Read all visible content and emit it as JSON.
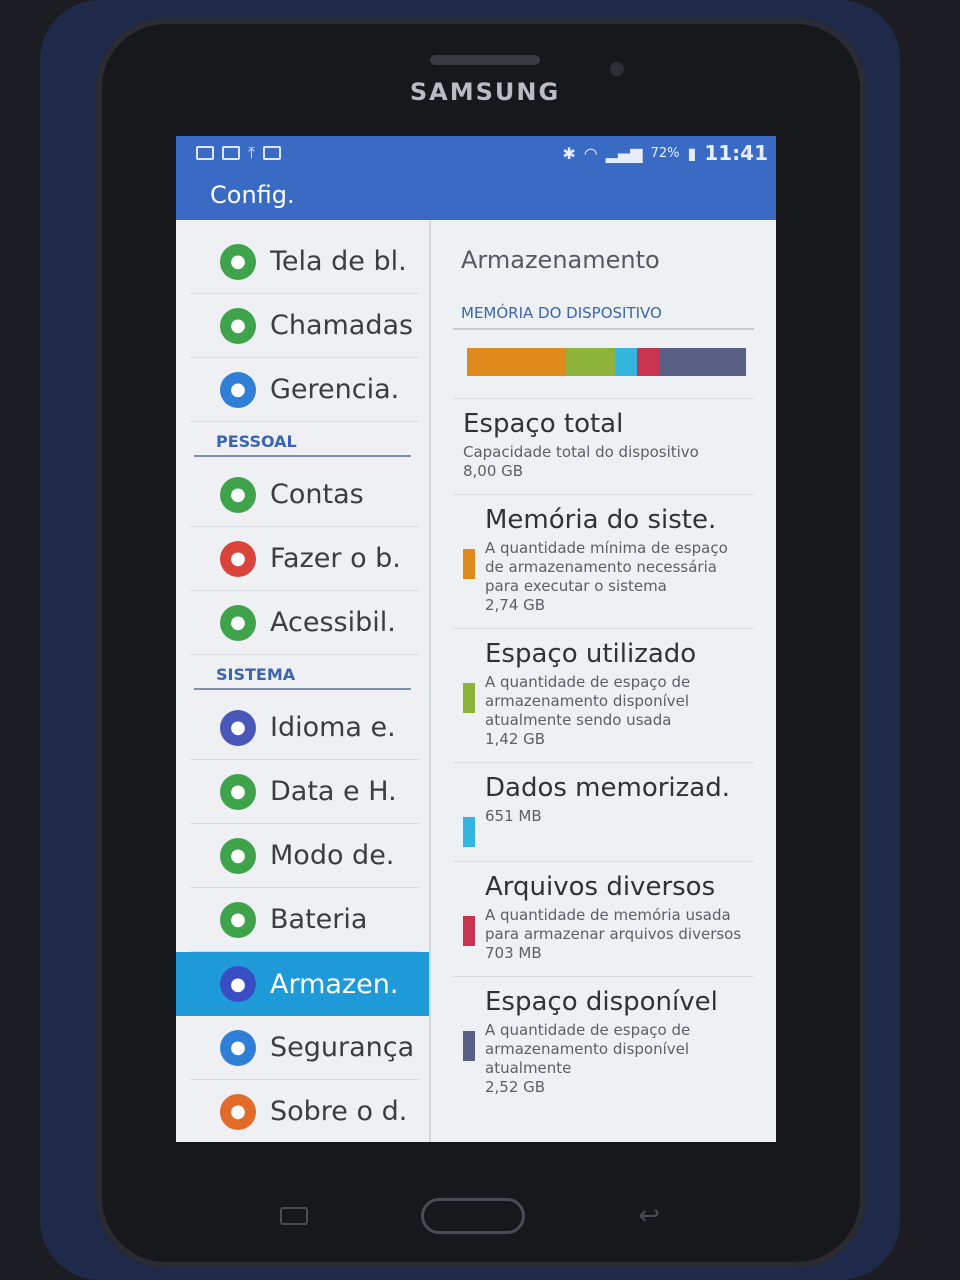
{
  "device": {
    "brand": "SAMSUNG"
  },
  "status_bar": {
    "battery": "72%",
    "time": "11:41"
  },
  "app_title": "Config.",
  "sidebar": {
    "items_top": [
      {
        "label": "Tela de bl.",
        "icon": "lock-screen-icon",
        "color": "#3ea34a"
      },
      {
        "label": "Chamadas",
        "icon": "phone-icon",
        "color": "#3ea34a"
      },
      {
        "label": "Gerencia.",
        "icon": "grid-icon",
        "color": "#2f7fd6"
      }
    ],
    "section_personal": "PESSOAL",
    "items_personal": [
      {
        "label": "Contas",
        "icon": "key-icon",
        "color": "#3ea34a"
      },
      {
        "label": "Fazer o b.",
        "icon": "backup-icon",
        "color": "#d9433a"
      },
      {
        "label": "Acessibil.",
        "icon": "hand-icon",
        "color": "#3ea34a"
      }
    ],
    "section_system": "SISTEMA",
    "items_system": [
      {
        "label": "Idioma e.",
        "icon": "language-icon",
        "color": "#4a57b8"
      },
      {
        "label": "Data e H.",
        "icon": "calendar-icon",
        "color": "#3ea34a"
      },
      {
        "label": "Modo de.",
        "icon": "mode-icon",
        "color": "#3ea34a"
      },
      {
        "label": "Bateria",
        "icon": "battery-icon",
        "color": "#3ea34a"
      },
      {
        "label": "Armazen.",
        "icon": "storage-icon",
        "color": "#3a4ec4",
        "active": true
      },
      {
        "label": "Segurança",
        "icon": "security-icon",
        "color": "#2f7fd6"
      },
      {
        "label": "Sobre o d.",
        "icon": "info-icon",
        "color": "#e26b2b"
      }
    ]
  },
  "storage": {
    "title": "Armazenamento",
    "section_label": "MEMÓRIA DO DISPOSITIVO",
    "usage_bar": [
      {
        "name": "system",
        "fraction": 0.35,
        "color": "#e08a1e"
      },
      {
        "name": "used",
        "fraction": 0.18,
        "color": "#8db33a"
      },
      {
        "name": "cached",
        "fraction": 0.08,
        "color": "#34b5e0"
      },
      {
        "name": "misc",
        "fraction": 0.08,
        "color": "#c8344f"
      },
      {
        "name": "available",
        "fraction": 0.31,
        "color": "#5a5f86"
      }
    ],
    "total": {
      "title": "Espaço total",
      "desc": "Capacidade total do dispositivo",
      "value": "8,00 GB"
    },
    "items": [
      {
        "title": "Memória do siste.",
        "desc": "A quantidade mínima de espaço de armazenamento necessária para executar o sistema",
        "value": "2,74 GB",
        "color": "#e08a1e"
      },
      {
        "title": "Espaço utilizado",
        "desc": "A quantidade de espaço de armazenamento disponível atualmente sendo usada",
        "value": "1,42 GB",
        "color": "#8db33a"
      },
      {
        "title": "Dados memorizad.",
        "desc": "",
        "value": "651 MB",
        "color": "#34b5e0"
      },
      {
        "title": "Arquivos diversos",
        "desc": "A quantidade de memória usada para armazenar arquivos diversos",
        "value": "703 MB",
        "color": "#c8344f"
      },
      {
        "title": "Espaço disponível",
        "desc": "A quantidade de espaço de armazenamento disponível atualmente",
        "value": "2,52 GB",
        "color": "#5a5f86"
      }
    ]
  }
}
